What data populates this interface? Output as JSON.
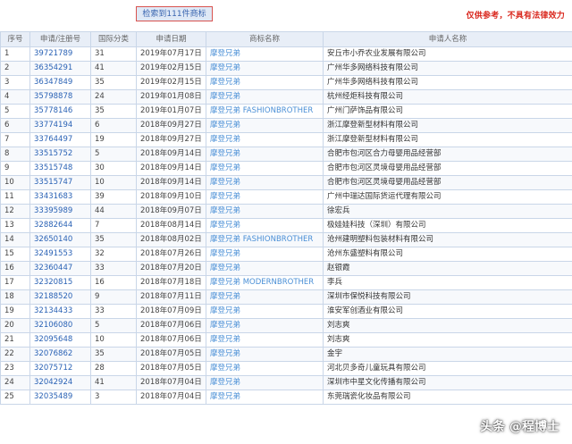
{
  "header": {
    "search_summary": "检索到111件商标",
    "disclaimer": "仅供参考，不具有法律效力"
  },
  "table": {
    "columns": [
      "序号",
      "申请/注册号",
      "国际分类",
      "申请日期",
      "商标名称",
      "申请人名称"
    ],
    "rows": [
      {
        "no": "1",
        "reg": "39721789",
        "cls": "31",
        "date": "2019年07月17日",
        "mark": "摩登兄弟",
        "applicant": "安丘市小乔农业发展有限公司"
      },
      {
        "no": "2",
        "reg": "36354291",
        "cls": "41",
        "date": "2019年02月15日",
        "mark": "摩登兄弟",
        "applicant": "广州华多网络科技有限公司"
      },
      {
        "no": "3",
        "reg": "36347849",
        "cls": "35",
        "date": "2019年02月15日",
        "mark": "摩登兄弟",
        "applicant": "广州华多网络科技有限公司"
      },
      {
        "no": "4",
        "reg": "35798878",
        "cls": "24",
        "date": "2019年01月08日",
        "mark": "摩登兄弟",
        "applicant": "杭州经炬科技有限公司"
      },
      {
        "no": "5",
        "reg": "35778146",
        "cls": "35",
        "date": "2019年01月07日",
        "mark": "摩登兄弟 FASHIONBROTHER",
        "applicant": "广州门萨饰品有限公司"
      },
      {
        "no": "6",
        "reg": "33774194",
        "cls": "6",
        "date": "2018年09月27日",
        "mark": "摩登兄弟",
        "applicant": "浙江摩登新型材料有限公司"
      },
      {
        "no": "7",
        "reg": "33764497",
        "cls": "19",
        "date": "2018年09月27日",
        "mark": "摩登兄弟",
        "applicant": "浙江摩登新型材料有限公司"
      },
      {
        "no": "8",
        "reg": "33515752",
        "cls": "5",
        "date": "2018年09月14日",
        "mark": "摩登兄弟",
        "applicant": "合肥市包河区合力母婴用品经营部"
      },
      {
        "no": "9",
        "reg": "33515748",
        "cls": "30",
        "date": "2018年09月14日",
        "mark": "摩登兄弟",
        "applicant": "合肥市包河区灵境母婴用品经营部"
      },
      {
        "no": "10",
        "reg": "33515747",
        "cls": "10",
        "date": "2018年09月14日",
        "mark": "摩登兄弟",
        "applicant": "合肥市包河区灵境母婴用品经营部"
      },
      {
        "no": "11",
        "reg": "33431683",
        "cls": "39",
        "date": "2018年09月10日",
        "mark": "摩登兄弟",
        "applicant": "广州中瑞达国际货运代理有限公司"
      },
      {
        "no": "12",
        "reg": "33395989",
        "cls": "44",
        "date": "2018年09月07日",
        "mark": "摩登兄弟",
        "applicant": "徐宏兵"
      },
      {
        "no": "13",
        "reg": "32882644",
        "cls": "7",
        "date": "2018年08月14日",
        "mark": "摩登兄弟",
        "applicant": "极娃娃科技（深圳）有限公司"
      },
      {
        "no": "14",
        "reg": "32650140",
        "cls": "35",
        "date": "2018年08月02日",
        "mark": "摩登兄弟 FASHIONBROTHER",
        "applicant": "沧州建明塑料包装材料有限公司"
      },
      {
        "no": "15",
        "reg": "32491553",
        "cls": "32",
        "date": "2018年07月26日",
        "mark": "摩登兄弟",
        "applicant": "沧州东盛塑料有限公司"
      },
      {
        "no": "16",
        "reg": "32360447",
        "cls": "33",
        "date": "2018年07月20日",
        "mark": "摩登兄弟",
        "applicant": "赵银霞"
      },
      {
        "no": "17",
        "reg": "32320815",
        "cls": "16",
        "date": "2018年07月18日",
        "mark": "摩登兄弟 MODERNBROTHER",
        "applicant": "李兵"
      },
      {
        "no": "18",
        "reg": "32188520",
        "cls": "9",
        "date": "2018年07月11日",
        "mark": "摩登兄弟",
        "applicant": "深圳市保悦科技有限公司"
      },
      {
        "no": "19",
        "reg": "32134433",
        "cls": "33",
        "date": "2018年07月09日",
        "mark": "摩登兄弟",
        "applicant": "淮安军创酒业有限公司"
      },
      {
        "no": "20",
        "reg": "32106080",
        "cls": "5",
        "date": "2018年07月06日",
        "mark": "摩登兄弟",
        "applicant": "刘志爽"
      },
      {
        "no": "21",
        "reg": "32095648",
        "cls": "10",
        "date": "2018年07月06日",
        "mark": "摩登兄弟",
        "applicant": "刘志爽"
      },
      {
        "no": "22",
        "reg": "32076862",
        "cls": "35",
        "date": "2018年07月05日",
        "mark": "摩登兄弟",
        "applicant": "金宇"
      },
      {
        "no": "23",
        "reg": "32075712",
        "cls": "28",
        "date": "2018年07月05日",
        "mark": "摩登兄弟",
        "applicant": "河北贝多奇儿童玩具有限公司"
      },
      {
        "no": "24",
        "reg": "32042924",
        "cls": "41",
        "date": "2018年07月04日",
        "mark": "摩登兄弟",
        "applicant": "深圳市中星文化传播有限公司"
      },
      {
        "no": "25",
        "reg": "32035489",
        "cls": "3",
        "date": "2018年07月04日",
        "mark": "摩登兄弟",
        "applicant": "东莞瑞瓷化妆品有限公司"
      }
    ]
  },
  "watermark": {
    "prefix": "头条",
    "at": "@",
    "name": "程博士"
  }
}
